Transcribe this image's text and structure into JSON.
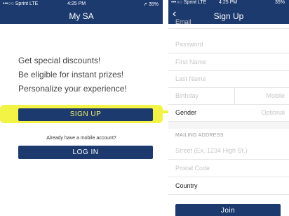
{
  "left": {
    "status": {
      "carrier": "•••○○ Sprint  LTE",
      "time": "4:25 PM",
      "battery": "➚ 35%"
    },
    "title": "My SA",
    "promo": [
      "Get special discounts!",
      "Be eligible for instant prizes!",
      "Personalize your experience!"
    ],
    "signup_label": "SIGN UP",
    "already_text": "Already have a mobile account?",
    "login_label": "LOG IN"
  },
  "right": {
    "status": {
      "carrier": "•••○○ Sprint  LTE",
      "time": "4:25 PM",
      "battery": "35%"
    },
    "title": "Sign Up",
    "fields": {
      "email": "Email",
      "password": "Password",
      "first_name": "First Name",
      "last_name": "Last Name",
      "birthday": "Birthday",
      "mobile": "Mobile",
      "gender": "Gender",
      "gender_hint": "Optional",
      "mailing_label": "MAILING ADDRESS",
      "street": "Street (Ex. 1234 High St.)",
      "postal": "Postal Code",
      "country": "Country"
    },
    "join_label": "Join"
  },
  "colors": {
    "brand_navy": "#1c3a6e",
    "highlight_yellow": "#f1f23a"
  }
}
